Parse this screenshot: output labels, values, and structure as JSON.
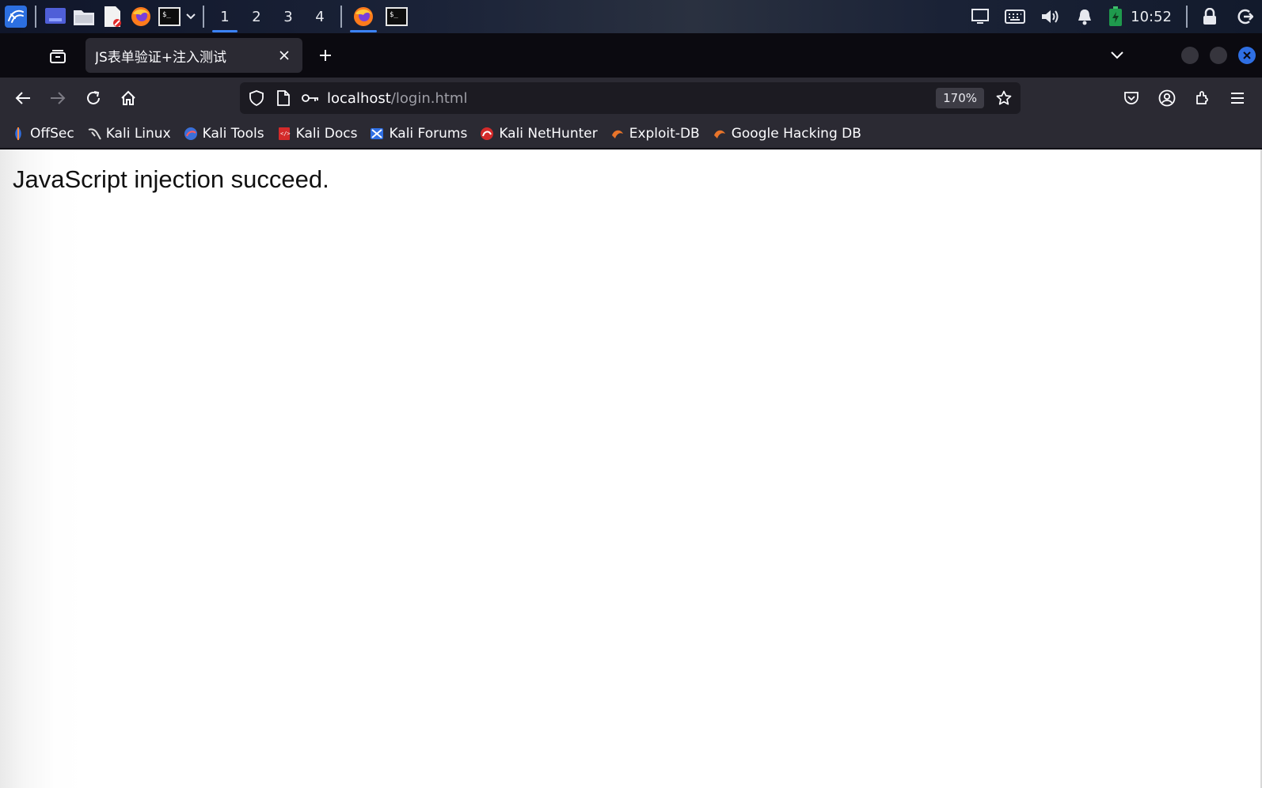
{
  "taskbar": {
    "workspaces": [
      "1",
      "2",
      "3",
      "4"
    ],
    "active_workspace": "1",
    "clock": "10:52",
    "icons": [
      "kali-dragon-icon",
      "desktop-icon",
      "file-manager-icon",
      "text-editor-icon",
      "firefox-icon",
      "terminal-icon",
      "chevron-down-icon",
      "display-icon",
      "keyboard-icon",
      "volume-icon",
      "bell-icon",
      "battery-icon",
      "lock-icon",
      "logout-icon"
    ]
  },
  "browser": {
    "tab": {
      "title": "JS表单验证+注入测试"
    },
    "url": {
      "host": "localhost",
      "path": "/login.html"
    },
    "zoom": "170%",
    "bookmarks": [
      {
        "label": "OffSec",
        "icon": "offsec-icon",
        "color": "#2f6fe3"
      },
      {
        "label": "Kali Linux",
        "icon": "kali-icon",
        "color": "#1a1a1a"
      },
      {
        "label": "Kali Tools",
        "icon": "kali-tools-icon",
        "color": "#3b6fd8"
      },
      {
        "label": "Kali Docs",
        "icon": "kali-docs-icon",
        "color": "#d42a2a"
      },
      {
        "label": "Kali Forums",
        "icon": "kali-forums-icon",
        "color": "#2f6fe3"
      },
      {
        "label": "Kali NetHunter",
        "icon": "nethunter-icon",
        "color": "#d42a2a"
      },
      {
        "label": "Exploit-DB",
        "icon": "exploit-db-icon",
        "color": "#e8742a"
      },
      {
        "label": "Google Hacking DB",
        "icon": "ghdb-icon",
        "color": "#e8742a"
      }
    ]
  },
  "page": {
    "message": "JavaScript injection succeed."
  },
  "colors": {
    "accent": "#3b82f6",
    "close_button": "#2f6fe3",
    "toolbar": "#2b2a33",
    "tabstrip": "#0b0a10"
  }
}
